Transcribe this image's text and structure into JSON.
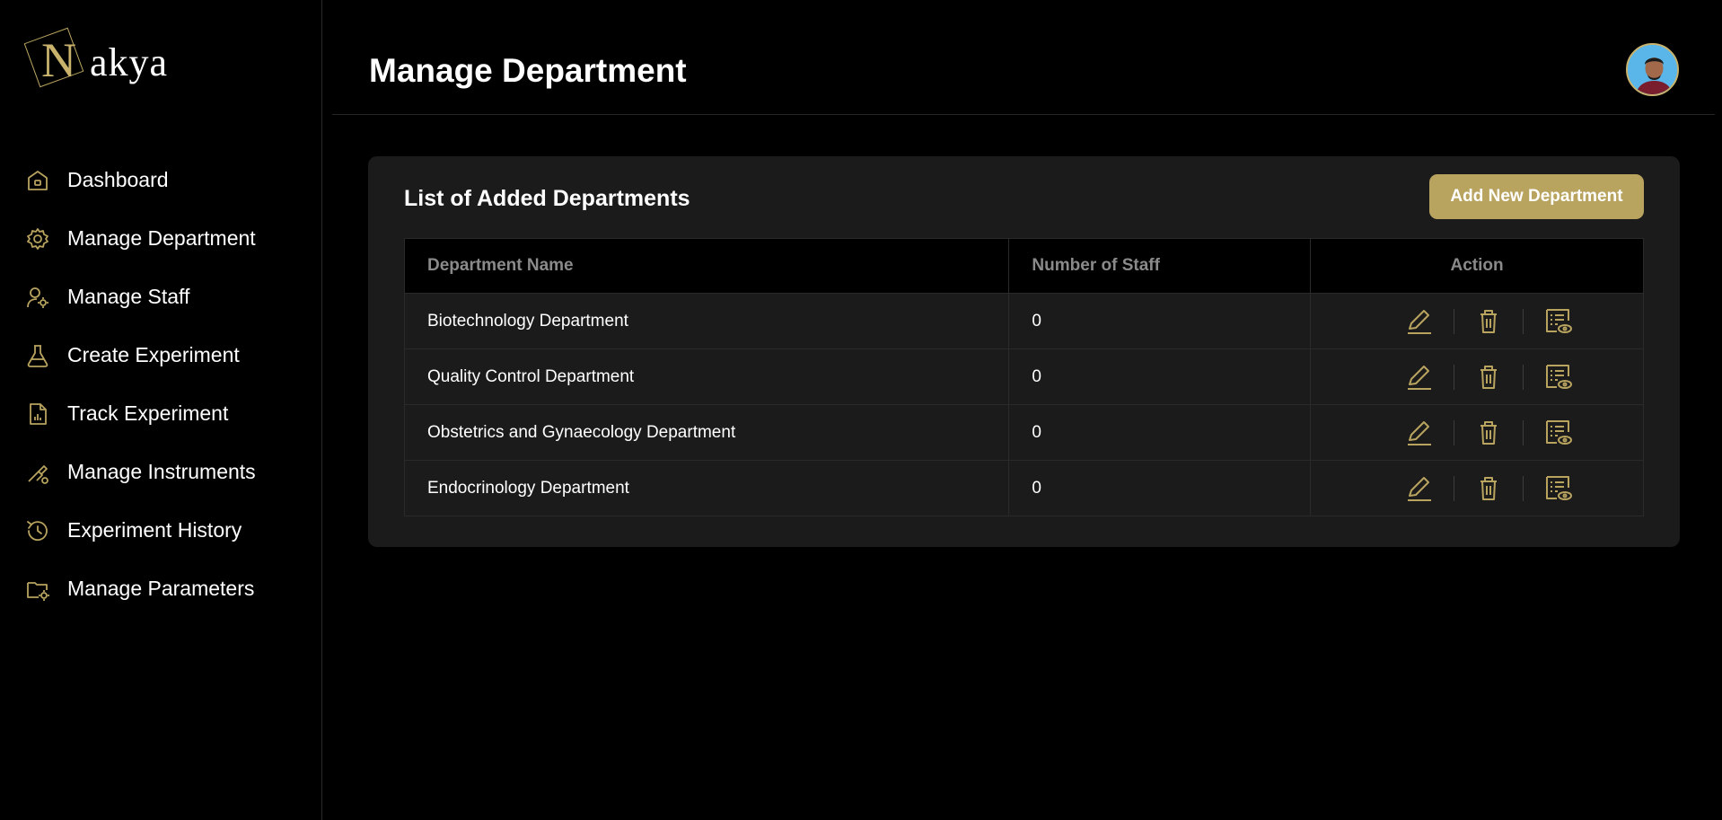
{
  "app": {
    "logo_initial": "N",
    "logo_rest": "akya",
    "accent_color": "#b8a35f"
  },
  "sidebar": {
    "items": [
      {
        "label": "Dashboard",
        "icon": "home-icon"
      },
      {
        "label": "Manage Department",
        "icon": "gear-icon"
      },
      {
        "label": "Manage Staff",
        "icon": "user-gear-icon"
      },
      {
        "label": "Create Experiment",
        "icon": "flask-icon"
      },
      {
        "label": "Track Experiment",
        "icon": "file-chart-icon"
      },
      {
        "label": "Manage Instruments",
        "icon": "instrument-icon"
      },
      {
        "label": "Experiment History",
        "icon": "history-icon"
      },
      {
        "label": "Manage Parameters",
        "icon": "folder-gear-icon"
      }
    ]
  },
  "header": {
    "title": "Manage Department",
    "avatar_icon": "user-avatar"
  },
  "main": {
    "card_title": "List of Added Departments",
    "add_button_label": "Add New Department",
    "table": {
      "columns": [
        "Department Name",
        "Number of Staff",
        "Action"
      ],
      "rows": [
        {
          "name": "Biotechnology Department",
          "staff": "0"
        },
        {
          "name": "Quality Control Department",
          "staff": "0"
        },
        {
          "name": "Obstetrics and Gynaecology Department",
          "staff": "0"
        },
        {
          "name": "Endocrinology Department",
          "staff": "0"
        }
      ],
      "action_icons": [
        "edit-icon",
        "trash-icon",
        "view-list-icon"
      ]
    }
  }
}
